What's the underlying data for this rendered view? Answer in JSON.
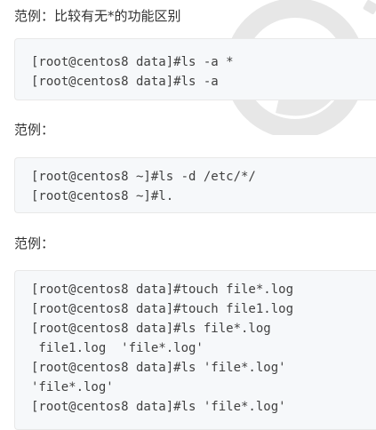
{
  "sections": [
    {
      "heading": "范例：比较有无*的功能区别",
      "lines": [
        "[root@centos8 data]#ls -a *",
        "[root@centos8 data]#ls -a"
      ]
    },
    {
      "heading": "范例：",
      "lines": [
        "[root@centos8 ~]#ls -d /etc/*/",
        "[root@centos8 ~]#l."
      ]
    },
    {
      "heading": "范例：",
      "lines": [
        "[root@centos8 data]#touch file*.log",
        "[root@centos8 data]#touch file1.log",
        "[root@centos8 data]#ls file*.log",
        " file1.log  'file*.log'",
        "[root@centos8 data]#ls 'file*.log'",
        "'file*.log'",
        "[root@centos8 data]#ls 'file*.log'"
      ]
    }
  ],
  "watermark_icon": "logo-watermark-icon",
  "colors": {
    "text": "#333333",
    "code_text": "#404040",
    "code_background": "#f6f8fa",
    "code_border": "#e8e8e8",
    "watermark": "#e3e3e3"
  }
}
